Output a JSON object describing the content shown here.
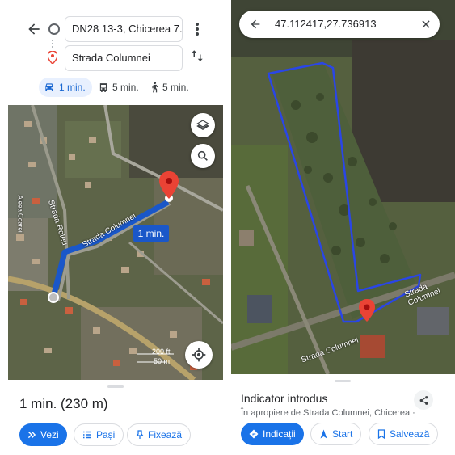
{
  "left": {
    "origin": "DN28 13-3, Chicerea 7...",
    "destination": "Strada Columnei",
    "modes": [
      {
        "icon": "car-icon",
        "label": "1 min.",
        "active": true
      },
      {
        "icon": "bus-icon",
        "label": "5 min."
      },
      {
        "icon": "walk-icon",
        "label": "5 min."
      }
    ],
    "map": {
      "route_time": "1 min.",
      "street_labels": [
        "Strada Columnei",
        "Strada Releu",
        "Aleea Coarei"
      ],
      "scale": [
        "200 ft",
        "50 m"
      ]
    },
    "summary": "1 min. (230 m)",
    "buttons": {
      "start": "Vezi",
      "steps": "Pași",
      "pin": "Fixează"
    }
  },
  "right": {
    "search_value": "47.112417,27.736913",
    "map": {
      "street_labels": [
        "Strada Columnei",
        "Strada Columnei"
      ]
    },
    "title": "Indicator introdus",
    "subtitle": "În apropiere de Strada Columnei, Chicerea ·",
    "buttons": {
      "directions": "Indicații",
      "start": "Start",
      "save": "Salvează"
    }
  },
  "colors": {
    "accent": "#1a73e8",
    "route": "#1a57c9",
    "pin": "#ea4335"
  }
}
